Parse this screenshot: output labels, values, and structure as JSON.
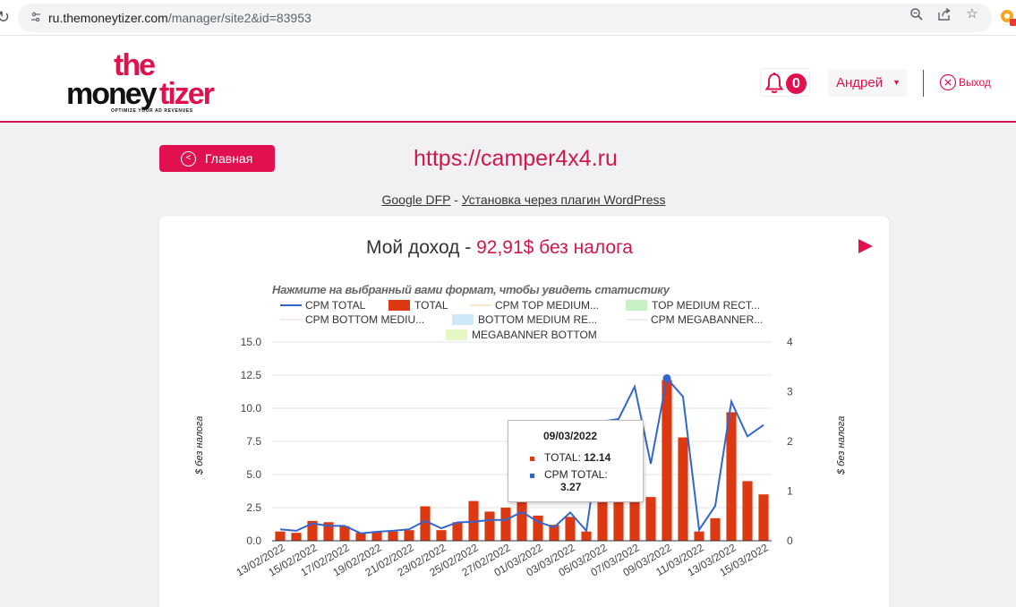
{
  "browser": {
    "url_host": "ru.themoneytizer.com",
    "url_path": "/manager/site2&id=83953"
  },
  "header": {
    "logo_top": "the",
    "logo_bottom_left": "money",
    "logo_bottom_right": "tizer",
    "logo_tagline": "OPTIMIZE YOUR AD REVENUES",
    "notifications_count": "0",
    "user_name": "Андрей",
    "logout_label": "Выход"
  },
  "nav": {
    "home_button": "Главная",
    "site_title": "https://camper4x4.ru",
    "integration_link1": "Google DFP",
    "integration_sep": " - ",
    "integration_link2": "Установка через плагин WordPress"
  },
  "card": {
    "title_prefix": "Мой доход - ",
    "title_amount": "92,91$ без налога",
    "chart_note": "Нажмите на выбранный вами формат, чтобы увидеть статистику"
  },
  "chart_data": {
    "type": "bar",
    "legend": [
      {
        "label": "CPM TOTAL",
        "kind": "line",
        "color": "#3366cc"
      },
      {
        "label": "TOTAL",
        "kind": "bar",
        "color": "#dc3912"
      },
      {
        "label": "CPM TOP MEDIUM...",
        "kind": "line",
        "color": "#f5c89c"
      },
      {
        "label": "TOP MEDIUM RECT...",
        "kind": "bar",
        "color": "#c6f0c6"
      },
      {
        "label": "CPM BOTTOM MEDIU...",
        "kind": "line",
        "color": "#f2d0e4"
      },
      {
        "label": "BOTTOM MEDIUM RE...",
        "kind": "bar",
        "color": "#cfe8f7"
      },
      {
        "label": "CPM MEGABANNER...",
        "kind": "line",
        "color": "#dddddd"
      },
      {
        "label": "MEGABANNER BOTTOM",
        "kind": "bar",
        "color": "#e6f7c6"
      }
    ],
    "left_axis": {
      "title": "$ без налога",
      "min": 0,
      "max": 15,
      "ticks": [
        "0.0",
        "2.5",
        "5.0",
        "7.5",
        "10.0",
        "12.5",
        "15.0"
      ]
    },
    "right_axis": {
      "title": "$ без налога",
      "min": 0,
      "max": 4,
      "ticks": [
        "0",
        "1",
        "2",
        "3",
        "4"
      ]
    },
    "x_labels": [
      "13/02/2022",
      "15/02/2022",
      "17/02/2022",
      "19/02/2022",
      "21/02/2022",
      "23/02/2022",
      "25/02/2022",
      "27/02/2022",
      "01/03/2022",
      "03/03/2022",
      "05/03/2022",
      "07/03/2022",
      "09/03/2022",
      "11/03/2022",
      "13/03/2022",
      "15/03/2022"
    ],
    "series": [
      {
        "name": "TOTAL",
        "axis": "left",
        "values": [
          0.7,
          0.6,
          1.5,
          1.4,
          1.1,
          0.6,
          0.7,
          0.7,
          0.8,
          2.6,
          0.8,
          1.4,
          3.0,
          2.2,
          2.5,
          3.0,
          1.9,
          1.2,
          1.8,
          0.7,
          3.2,
          3.2,
          3.2,
          3.3,
          12.14,
          7.8,
          0.7,
          1.7,
          9.7,
          4.5,
          3.5
        ]
      },
      {
        "name": "CPM TOTAL",
        "axis": "right",
        "values": [
          0.23,
          0.2,
          0.35,
          0.3,
          0.3,
          0.15,
          0.18,
          0.2,
          0.23,
          0.4,
          0.25,
          0.37,
          0.38,
          0.42,
          0.42,
          0.58,
          0.38,
          0.27,
          0.57,
          0.2,
          2.4,
          2.45,
          3.1,
          1.55,
          3.27,
          2.9,
          0.22,
          0.7,
          2.8,
          2.1,
          2.33
        ]
      }
    ],
    "tooltip": {
      "date": "09/03/2022",
      "total_label": "TOTAL: ",
      "total_value": "12.14",
      "cpm_label": "CPM TOTAL:",
      "cpm_value": "3.27"
    }
  },
  "colors": {
    "brand": "#e0114e",
    "bar": "#dc3912",
    "line": "#3366cc"
  }
}
